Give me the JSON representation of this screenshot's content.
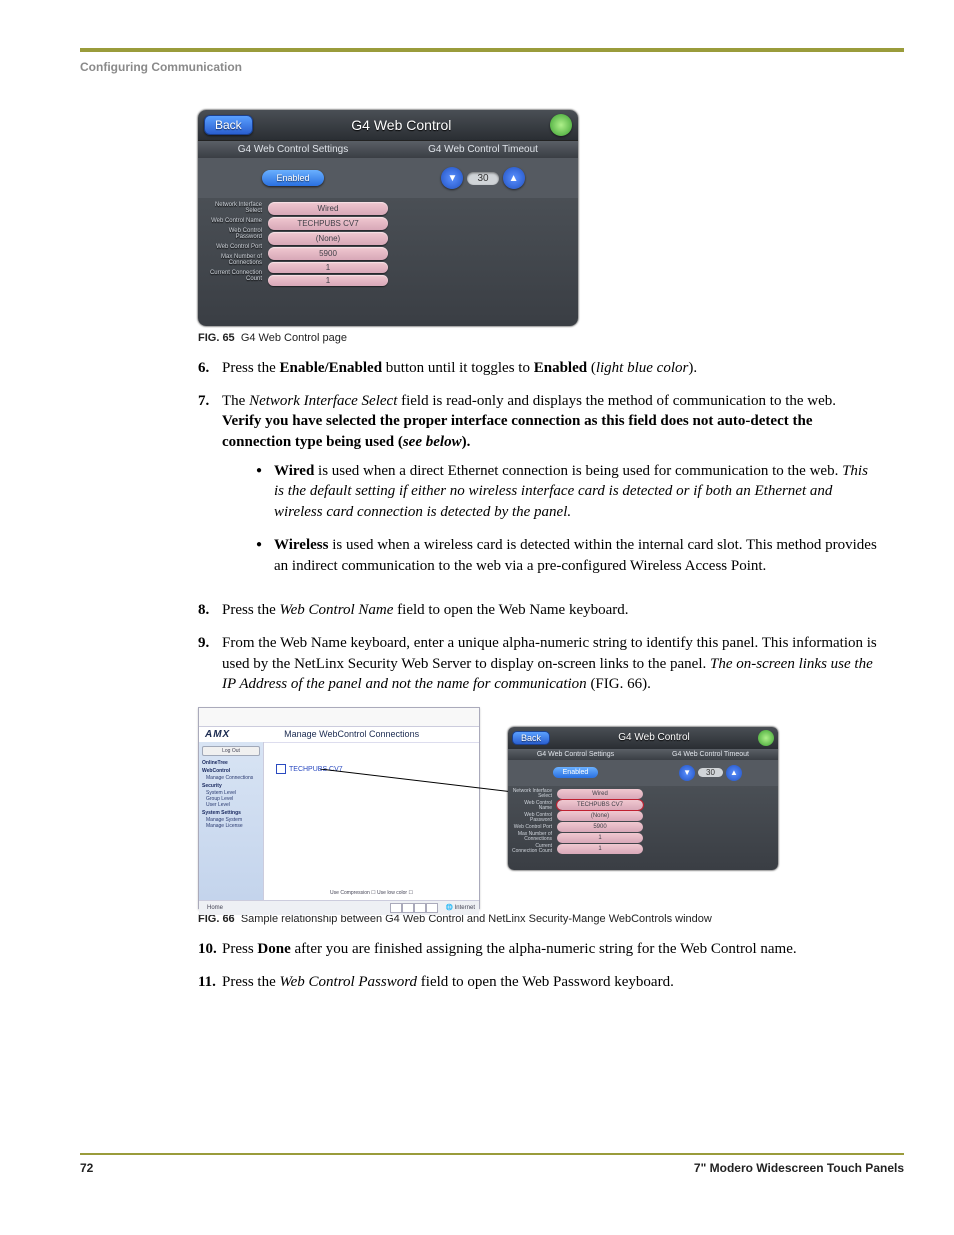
{
  "header": {
    "section": "Configuring Communication"
  },
  "footer": {
    "page": "72",
    "doc": "7\" Modero Widescreen Touch Panels"
  },
  "fig65": {
    "caption_tag": "FIG. 65",
    "caption_text": "G4 Web Control page",
    "back": "Back",
    "title": "G4 Web Control",
    "tab_left": "G4 Web Control Settings",
    "tab_right": "G4 Web Control Timeout",
    "enabled": "Enabled",
    "timeout": "30",
    "labels": {
      "l0": "Network Interface Select",
      "l1": "Web Control Name",
      "l2": "Web Control Password",
      "l3": "Web Control Port",
      "l4": "Max Number of Connections",
      "l5": "Current Connection Count"
    },
    "fields": {
      "f0": "Wired",
      "f1": "TECHPUBS CV7",
      "f2": "(None)",
      "f3": "5900",
      "f4": "1",
      "f5": "1"
    }
  },
  "steps": {
    "s6": {
      "num": "6.",
      "a": "Press the ",
      "b": "Enable/Enabled",
      "c": " button until it toggles to ",
      "d": "Enabled",
      "e": " (",
      "f": "light blue color",
      "g": ")."
    },
    "s7": {
      "num": "7.",
      "a": "The ",
      "b": "Network Interface Select",
      "c": " field is read-only and displays the method of communication to the web. ",
      "d": "Verify you have selected the proper interface connection as this field does not auto-detect the connection type being used (",
      "e": "see below",
      "f": ")."
    },
    "s8": {
      "num": "8.",
      "a": "Press the ",
      "b": "Web Control Name",
      "c": " field to open the Web Name keyboard."
    },
    "s9": {
      "num": "9.",
      "a": "From the Web Name keyboard, enter a unique alpha-numeric string to identify this panel. This information is used by the NetLinx Security Web Server to display on-screen links to the panel. ",
      "b": "The on-screen links use the IP Address of the panel and not the name for communication",
      "c": " (FIG. 66)."
    },
    "s10": {
      "num": "10.",
      "a": "Press ",
      "b": "Done",
      "c": " after you are finished assigning the alpha-numeric string for the Web Control name."
    },
    "s11": {
      "num": "11.",
      "a": "Press the ",
      "b": "Web Control Password",
      "c": " field to open the Web Password keyboard."
    }
  },
  "bullets": {
    "wired": {
      "a": "Wired",
      "b": " is used when a direct Ethernet connection is being used for communication to the web. ",
      "c": "This is the default setting if either no wireless interface card is detected or if both an Ethernet and wireless card connection is detected by the panel."
    },
    "wireless": {
      "a": "Wireless",
      "b": " is used when a wireless card is detected within the internal card slot. This method provides an indirect communication to the web via a pre-configured Wireless Access Point."
    }
  },
  "fig66": {
    "caption_tag": "FIG. 66",
    "caption_text": "Sample relationship between G4 Web Control and NetLinx Security-Mange WebControls window",
    "amx": {
      "logo": "AMX",
      "title": "Manage WebControl Connections",
      "login_btn": "Log Out",
      "g_online": "OnlineTree",
      "g_web": "WebControl",
      "i_web1": "Manage Connections",
      "g_sec": "Security",
      "i_sec1": "System Level",
      "i_sec2": "Group Level",
      "i_sec3": "User Level",
      "g_sys": "System Settings",
      "i_sys1": "Manage System",
      "i_sys2": "Manage License",
      "link": "TECHPUBS CV7",
      "opts": "Use Compression ☐   Use low color ☐",
      "status_home": "Home",
      "status_net": "Internet"
    },
    "mini": {
      "back": "Back",
      "title": "G4 Web Control",
      "tab_left": "G4 Web Control Settings",
      "tab_right": "G4 Web Control Timeout",
      "enabled": "Enabled",
      "timeout": "30",
      "labels": {
        "l0": "Network Interface Select",
        "l1": "Web Control Name",
        "l2": "Web Control Password",
        "l3": "Web Control Port",
        "l4": "Max Number of Connections",
        "l5": "Current Connection Count"
      },
      "fields": {
        "f0": "Wired",
        "f1": "TECHPUBS CV7",
        "f2": "(None)",
        "f3": "5900",
        "f4": "1",
        "f5": "1"
      }
    }
  }
}
